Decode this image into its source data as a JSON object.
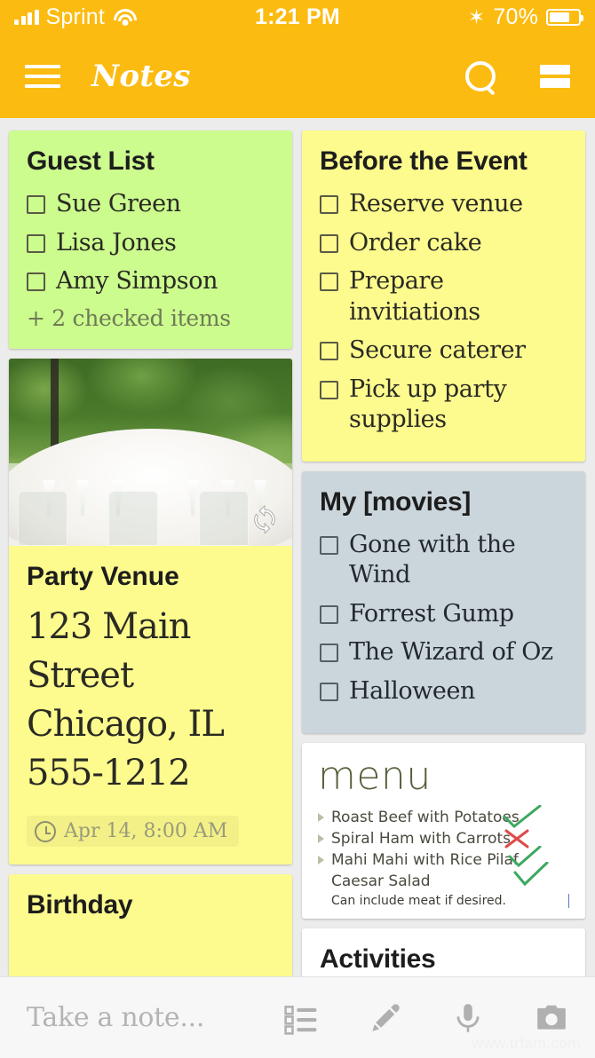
{
  "status_bar": {
    "carrier": "Sprint",
    "time": "1:21 PM",
    "battery_percent": "70%",
    "bluetooth_icon": "bluetooth-icon",
    "wifi_icon": "wifi-icon",
    "signal_icon": "cellular-signal-icon"
  },
  "app_bar": {
    "title": "Notes",
    "menu_icon": "hamburger-menu-icon",
    "search_icon": "search-icon",
    "view_toggle_icon": "list-view-toggle-icon"
  },
  "colors": {
    "accent": "#FCBB10",
    "card_green": "#CCFB8E",
    "card_yellow": "#FDFB8E",
    "card_bluegrey": "#CBD6DC",
    "card_white": "#FFFFFF",
    "board_bg": "#ECECEC",
    "check_green": "#3DA860",
    "cross_red": "#E04A4A"
  },
  "notes": {
    "guest_list": {
      "title": "Guest List",
      "items": [
        "Sue Green",
        "Lisa Jones",
        "Amy Simpson"
      ],
      "more_items": "+ 2 checked items"
    },
    "before_the_event": {
      "title": "Before the Event",
      "items": [
        "Reserve venue",
        "Order cake",
        "Prepare invitiations",
        "Secure caterer",
        "Pick up party supplies"
      ]
    },
    "party_venue": {
      "photo_alt": "outdoor-banquet-table-photo",
      "sync_icon": "sync-icon",
      "title": "Party Venue",
      "address_lines": [
        "123 Main Street",
        "Chicago, IL",
        "555-1212"
      ],
      "reminder": "Apr 14, 8:00 AM",
      "reminder_icon": "clock-icon"
    },
    "birthday": {
      "title": "Birthday"
    },
    "my_movies": {
      "title": "My [movies]",
      "items": [
        "Gone with the Wind",
        "Forrest Gump",
        "The Wizard of Oz",
        "Halloween"
      ]
    },
    "menu_image": {
      "heading": "menu",
      "items": [
        {
          "text": "Roast Beef with Potatoes",
          "mark": "check"
        },
        {
          "text": "Spiral Ham with Carrots",
          "mark": "cross"
        },
        {
          "text": "Mahi Mahi with Rice Pilaf",
          "mark": "check"
        },
        {
          "text": "Caesar Salad",
          "mark": "check"
        }
      ],
      "note": "Can include meat if desired."
    },
    "activities": {
      "title": "Activities"
    }
  },
  "bottom_bar": {
    "placeholder": "Take a note...",
    "checklist_icon": "checklist-icon",
    "draw_icon": "brush-icon",
    "voice_icon": "microphone-icon",
    "photo_icon": "camera-icon"
  },
  "watermark": "www.trfam.com"
}
